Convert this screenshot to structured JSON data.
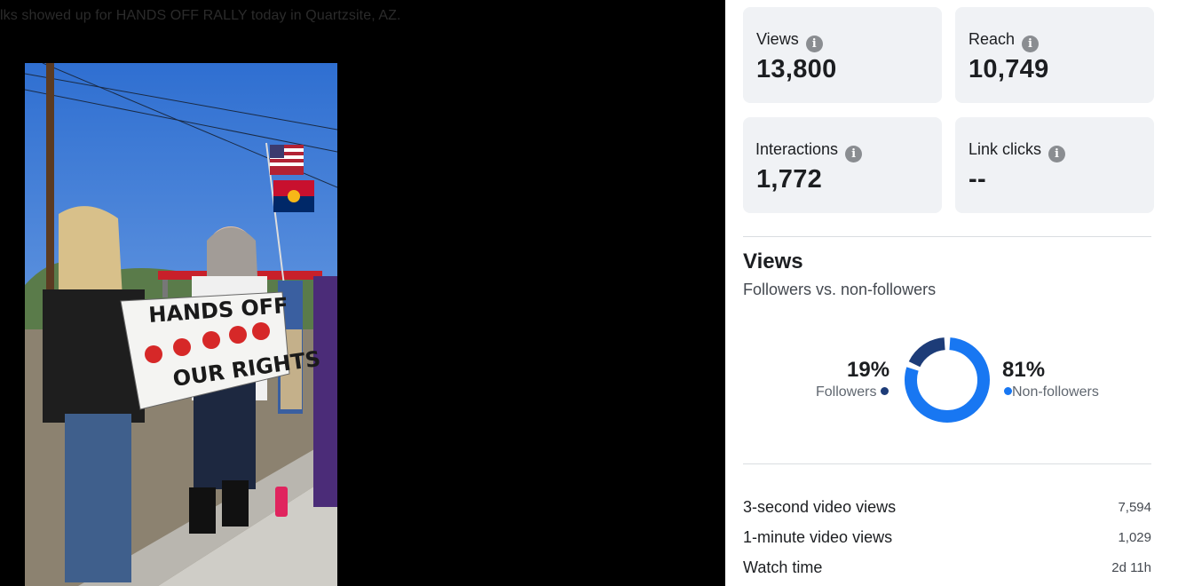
{
  "post": {
    "caption": "lks showed up for HANDS OFF RALLY today in Quartzsite, AZ."
  },
  "video": {
    "banner_line1": "HANDS OFF",
    "banner_line2": "OUR RIGHTS"
  },
  "insights": {
    "cards": [
      {
        "label": "Views",
        "value": "13,800"
      },
      {
        "label": "Reach",
        "value": "10,749"
      },
      {
        "label": "Interactions",
        "value": "1,772"
      },
      {
        "label": "Link clicks",
        "value": "--"
      }
    ],
    "info_icon": "i",
    "views_section": {
      "title": "Views",
      "subtitle": "Followers vs. non-followers",
      "followers_pct": "19%",
      "followers_label": "Followers",
      "non_followers_pct": "81%",
      "non_followers_label": "Non-followers",
      "followers_fraction": 0.19,
      "non_followers_fraction": 0.81,
      "followers_color": "#1d3c78",
      "non_followers_color": "#1877f2"
    },
    "metrics": [
      {
        "label": "3-second video views",
        "value": "7,594"
      },
      {
        "label": "1-minute video views",
        "value": "1,029"
      },
      {
        "label": "Watch time",
        "value": "2d 11h"
      }
    ]
  }
}
